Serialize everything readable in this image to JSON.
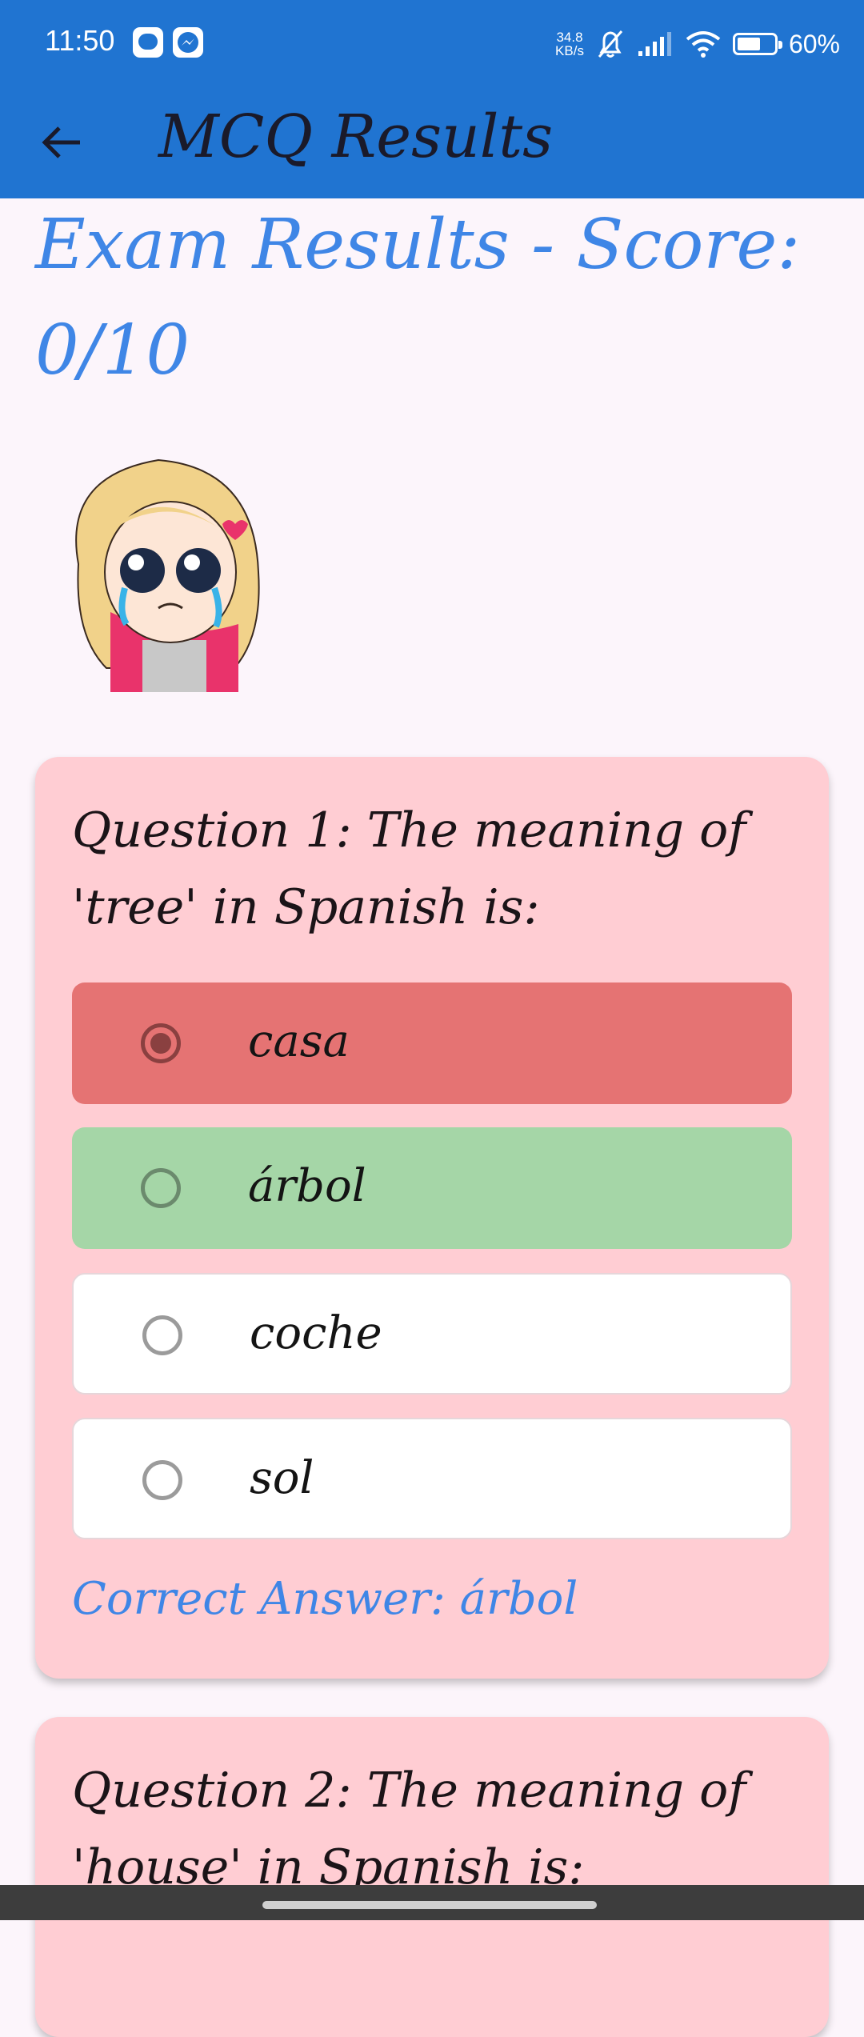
{
  "status": {
    "time": "11:50",
    "net_speed_value": "34.8",
    "net_speed_unit": "KB/s",
    "battery": "60%",
    "icons": [
      "chat-app-icon",
      "messenger-app-icon",
      "bell-off-icon",
      "signal-icon",
      "wifi-icon",
      "battery-icon"
    ]
  },
  "appbar": {
    "title": "MCQ Results",
    "back_icon": "arrow-left-icon"
  },
  "score_title": "Exam Results - Score: 0/10",
  "questions": [
    {
      "text": "Question 1: The meaning of 'tree' in Spanish is:",
      "options": [
        "casa",
        "árbol",
        "coche",
        "sol"
      ],
      "selected": "casa",
      "correct_label": "Correct Answer: árbol"
    },
    {
      "text": "Question 2: The meaning of 'house' in Spanish is:"
    }
  ],
  "colors": {
    "app_bar": "#2074d1",
    "accent_text": "#3f86e6",
    "card": "#ffcdd3",
    "wrong_option": "#e57373",
    "correct_option": "#a5d6a7"
  }
}
